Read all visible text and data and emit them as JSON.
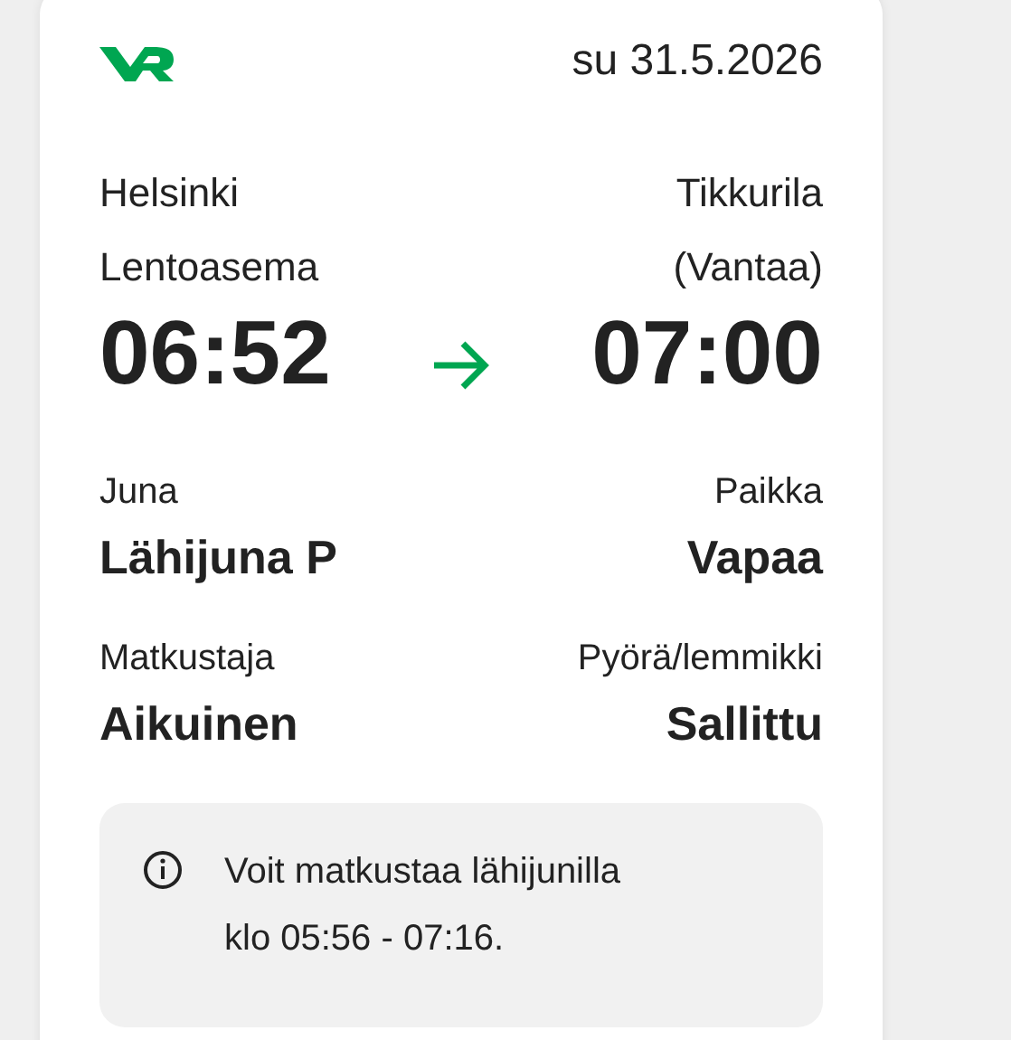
{
  "date": "su 31.5.2026",
  "route": {
    "from": {
      "line1": "Helsinki",
      "line2": "Lentoasema",
      "time": "06:52"
    },
    "to": {
      "line1": "Tikkurila",
      "line2": "(Vantaa)",
      "time": "07:00"
    }
  },
  "details": [
    {
      "label": "Juna",
      "value": "Lähijuna P"
    },
    {
      "label": "Paikka",
      "value": "Vapaa"
    },
    {
      "label": "Matkustaja",
      "value": "Aikuinen"
    },
    {
      "label": "Pyörä/lemmikki",
      "value": "Sallittu"
    }
  ],
  "info": {
    "lines": [
      "Voit matkustaa lähijunilla",
      "klo 05:56 - 07:16."
    ]
  }
}
